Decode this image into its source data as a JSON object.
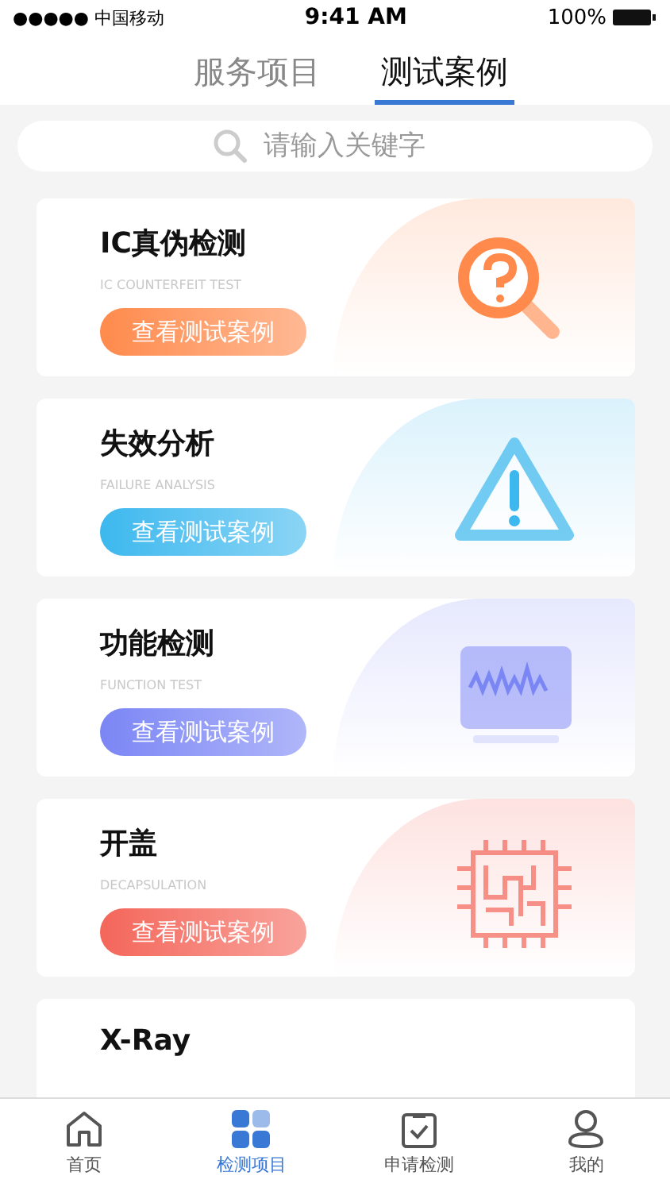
{
  "status_bar": {
    "carrier": "●●●●● 中国移动",
    "time": "9:41 AM",
    "battery": "100%"
  },
  "tabs": [
    {
      "label": "服务项目",
      "selected": false
    },
    {
      "label": "测试案例",
      "selected": true
    }
  ],
  "search": {
    "placeholder": "请输入关键字"
  },
  "cases": [
    {
      "kind": "magnifier",
      "title": "IC真伪检测",
      "subtitle": "IC COUNTERFEIT TEST",
      "button": "查看测试案例",
      "color": "#ff8a4c"
    },
    {
      "kind": "warning",
      "title": "失效分析",
      "subtitle": "FAILURE ANALYSIS",
      "button": "查看测试案例",
      "color": "#3db8ee"
    },
    {
      "kind": "monitor",
      "title": "功能检测",
      "subtitle": "FUNCTION TEST",
      "button": "查看测试案例",
      "color": "#7b86f5"
    },
    {
      "kind": "chip",
      "title": "开盖",
      "subtitle": "DECAPSULATION",
      "button": "查看测试案例",
      "color": "#f4665a"
    },
    {
      "kind": "none",
      "title": "X-Ray"
    }
  ],
  "tab_bar": [
    {
      "kind": "home",
      "label": "首页",
      "selected": false
    },
    {
      "kind": "grid",
      "label": "检测项目",
      "selected": true
    },
    {
      "kind": "clipboard",
      "label": "申请检测",
      "selected": false
    },
    {
      "kind": "user",
      "label": "我的",
      "selected": false
    }
  ]
}
